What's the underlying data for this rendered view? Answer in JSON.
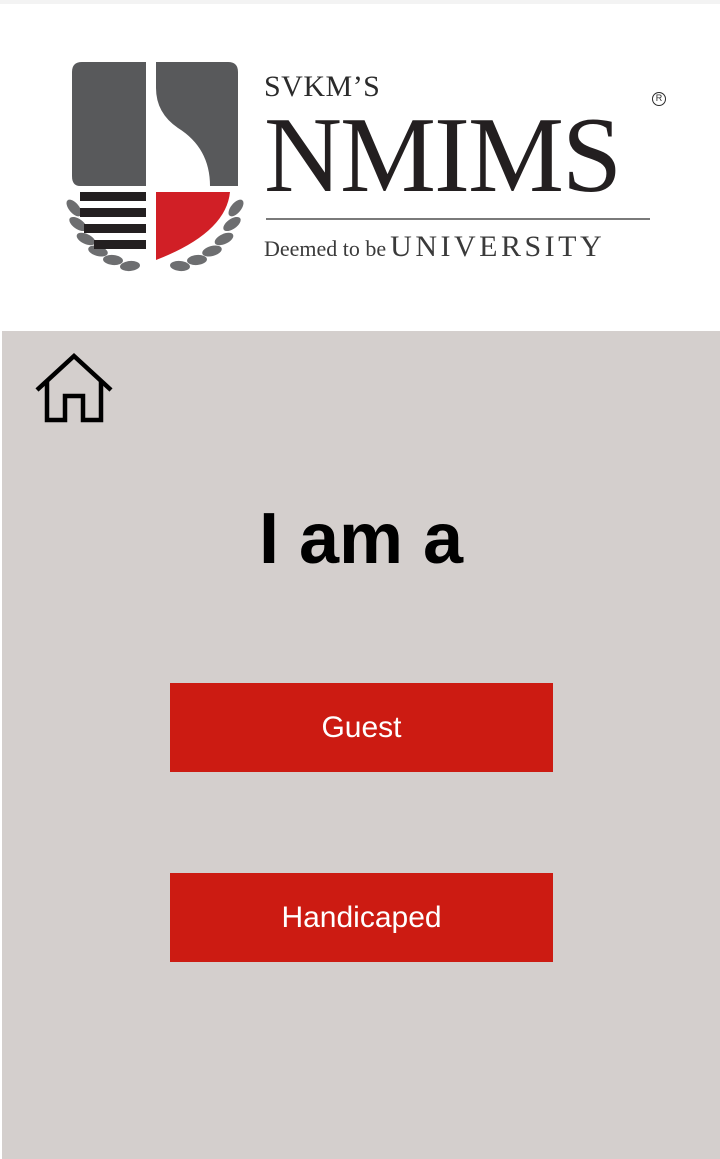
{
  "header": {
    "logo": {
      "prefix": "SVKM’S",
      "name": "NMIMS",
      "registered_mark": "R",
      "tagline_small": "Deemed to be",
      "tagline_big": "UNIVERSITY",
      "colors": {
        "dark_gray": "#58595b",
        "red": "#d11f26",
        "black": "#231f20"
      }
    }
  },
  "main": {
    "home_icon": "home-icon",
    "title": "I am a",
    "options": [
      {
        "label": "Guest"
      },
      {
        "label": "Handicaped"
      }
    ]
  },
  "colors": {
    "background": "#d4cfcd",
    "button": "#cc1b12",
    "button_text": "#ffffff"
  }
}
